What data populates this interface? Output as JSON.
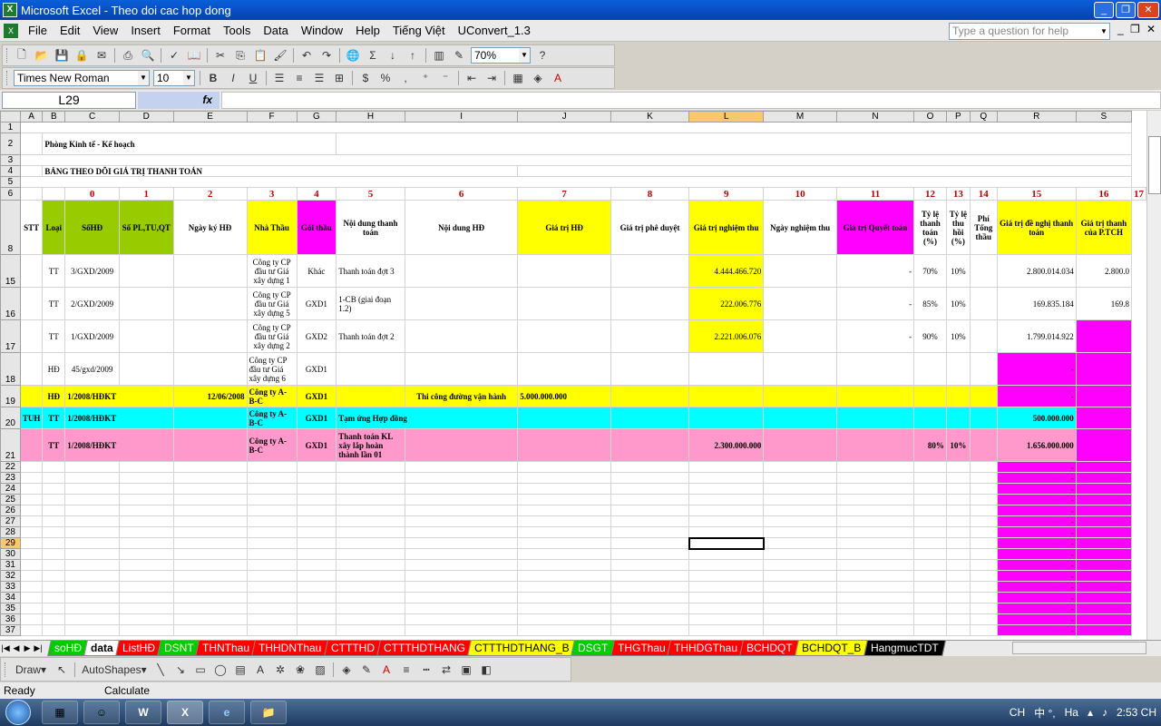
{
  "window": {
    "title": "Microsoft Excel - Theo doi cac hop dong"
  },
  "menu": [
    "File",
    "Edit",
    "View",
    "Insert",
    "Format",
    "Tools",
    "Data",
    "Window",
    "Help",
    "Tiếng Việt",
    "UConvert_1.3"
  ],
  "help_placeholder": "Type a question for help",
  "toolbar": {
    "zoom": "70%",
    "font": "Times New Roman",
    "size": "10"
  },
  "formula": {
    "cell": "L29",
    "fx": "fx"
  },
  "colors": {
    "yellow": "#ffff00",
    "green": "#99cc00",
    "magenta": "#ff00ff",
    "cyan": "#00ffff",
    "pink": "#ff99cc",
    "red_num": "#c00000"
  },
  "columns": [
    "A",
    "B",
    "C",
    "D",
    "E",
    "F",
    "G",
    "H",
    "I",
    "J",
    "K",
    "L",
    "M",
    "N",
    "O",
    "P",
    "Q",
    "R",
    "S"
  ],
  "row_labels": {
    "r1": "1",
    "r2": "2",
    "r3": "3",
    "r4": "4",
    "r5": "5",
    "r6": "6",
    "r8": "8",
    "r15": "15",
    "r16": "16",
    "r17": "17",
    "r18": "18",
    "r19": "19",
    "r20": "20",
    "r21": "21"
  },
  "blank_rows": [
    "22",
    "23",
    "24",
    "25",
    "26",
    "27",
    "28",
    "29",
    "30",
    "31",
    "32",
    "33",
    "34",
    "35",
    "36",
    "37"
  ],
  "sheet": {
    "dept": "Phòng Kinh tế - Kế hoạch",
    "title": "BẢNG THEO DÕI GIÁ TRỊ THANH TOÁN",
    "index_row": [
      "0",
      "1",
      "2",
      "3",
      "4",
      "5",
      "6",
      "7",
      "8",
      "9",
      "10",
      "11",
      "12",
      "13",
      "14",
      "15",
      "16",
      "17"
    ],
    "headers": [
      "STT",
      "Loại",
      "SốHĐ",
      "Số PL,TU,QT",
      "Ngày ký HĐ",
      "Nhà Thầu",
      "Gói thầu",
      "Nội dung thanh toán",
      "Nội dung HĐ",
      "Giá trị HĐ",
      "Giá trị phê duyệt",
      "Giá trị nghiệm thu",
      "Ngày nghiệm thu",
      "Giá trị Quyết toán",
      "Tỷ lệ thanh toán (%)",
      "Tỷ lệ thu hồi (%)",
      "Phí Tổng thầu",
      "Giá trị đề nghị thanh toán",
      "Giá trị thanh của P.TCH"
    ],
    "r15": {
      "b": "TT",
      "c": "3/GXD/2009",
      "f": "Công ty CP đầu tư Giá xây dựng 1",
      "g": "Khác",
      "h": "Thanh toán đợt 3",
      "l": "4.444.466.720",
      "n": "-",
      "o": "70%",
      "p": "10%",
      "r": "2.800.014.034",
      "s": "2.800.0"
    },
    "r16": {
      "b": "TT",
      "c": "2/GXD/2009",
      "f": "Công ty CP đầu tư Giá xây dựng 5",
      "g": "GXD1",
      "h": "1-CB (giai đoạn 1.2)",
      "l": "222.006.776",
      "n": "-",
      "o": "85%",
      "p": "10%",
      "r": "169.835.184",
      "s": "169.8"
    },
    "r17": {
      "b": "TT",
      "c": "1/GXD/2009",
      "f": "Công ty CP đầu tư Giá xây dựng 2",
      "g": "GXD2",
      "h": "Thanh toán đợt 2",
      "l": "2.221.006.076",
      "n": "-",
      "o": "90%",
      "p": "10%",
      "r": "1.799.014.922"
    },
    "r18": {
      "b": "HĐ",
      "c": "45/gxd/2009",
      "f": "Công ty CP đầu tư Giá xây dựng 6",
      "g": "GXD1",
      "r": "-"
    },
    "r19": {
      "b": "HĐ",
      "c": "1/2008/HĐKT",
      "e": "12/06/2008",
      "f": "Công ty A-B-C",
      "g": "GXD1",
      "i": "Thi công đường vận hành",
      "j": "5.000.000.000",
      "r": "-"
    },
    "r20": {
      "a": "TUH",
      "b": "TT",
      "c": "1/2008/HĐKT",
      "f": "Công ty A-B-C",
      "g": "GXD1",
      "h": "Tạm ứng Hợp đồng",
      "r": "500.000.000"
    },
    "r21": {
      "b": "TT",
      "c": "1/2008/HĐKT",
      "f": "Công ty A-B-C",
      "g": "GXD1",
      "h": "Thanh toán KL xây lắp hoàn thành lần 01",
      "l": "2.300.000.000",
      "o": "80%",
      "p": "10%",
      "r": "1.656.000.000"
    },
    "dash": "-"
  },
  "tabs": [
    {
      "label": "soHĐ",
      "bg": "#00cc00",
      "fg": "#ffffff"
    },
    {
      "label": "data",
      "bg": "#ffffff",
      "fg": "#000000"
    },
    {
      "label": "ListHĐ",
      "bg": "#ff0000",
      "fg": "#ffffff"
    },
    {
      "label": "DSNT",
      "bg": "#00cc00",
      "fg": "#ffffff"
    },
    {
      "label": "THNThau",
      "bg": "#ff0000",
      "fg": "#ffffff"
    },
    {
      "label": "THHDNThau",
      "bg": "#ff0000",
      "fg": "#ffffff"
    },
    {
      "label": "CTTTHD",
      "bg": "#ff0000",
      "fg": "#ffffff"
    },
    {
      "label": "CTTTHDTHANG",
      "bg": "#ff0000",
      "fg": "#ffffff"
    },
    {
      "label": "CTTTHDTHANG_B",
      "bg": "#ffff00",
      "fg": "#000000"
    },
    {
      "label": "DSGT",
      "bg": "#00cc00",
      "fg": "#ffffff"
    },
    {
      "label": "THGThau",
      "bg": "#ff0000",
      "fg": "#ffffff"
    },
    {
      "label": "THHDGThau",
      "bg": "#ff0000",
      "fg": "#ffffff"
    },
    {
      "label": "BCHDQT",
      "bg": "#ff0000",
      "fg": "#ffffff"
    },
    {
      "label": "BCHDQT_B",
      "bg": "#ffff00",
      "fg": "#000000"
    },
    {
      "label": "HangmucTDT",
      "bg": "#000000",
      "fg": "#ffffff"
    }
  ],
  "drawbar": {
    "draw": "Draw",
    "autoshapes": "AutoShapes"
  },
  "status": {
    "left": "Ready",
    "mid": "Calculate"
  },
  "taskbar": {
    "lang": "CH",
    "ime": "Ha",
    "clock": "2:53 CH"
  }
}
